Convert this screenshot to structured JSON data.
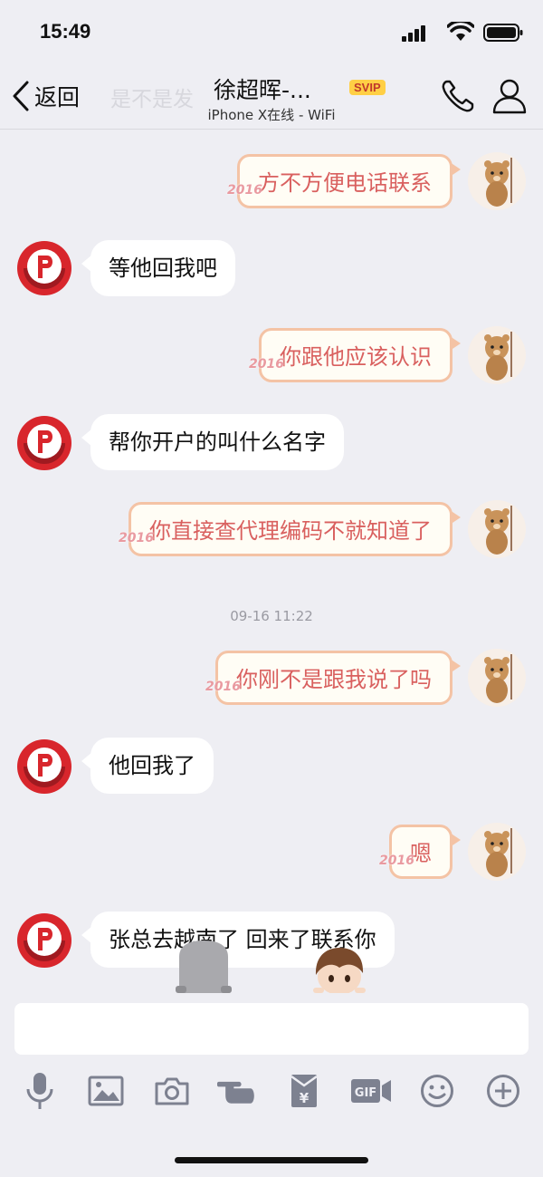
{
  "status_bar": {
    "time": "15:49"
  },
  "header": {
    "back_label": "返回",
    "ghost_text": "是不是发",
    "contact_name": "徐超晖-...",
    "badge": "SVIP",
    "subtitle": "iPhone X在线 - WiFi"
  },
  "messages": [
    {
      "side": "out",
      "text": "方不方便电话联系",
      "deco": "2016"
    },
    {
      "side": "in",
      "text": "等他回我吧"
    },
    {
      "side": "out",
      "text": "你跟他应该认识",
      "deco": "2016"
    },
    {
      "side": "in",
      "text": "帮你开户的叫什么名字"
    },
    {
      "side": "out",
      "text": "你直接查代理编码不就知道了",
      "deco": "2016"
    },
    {
      "side": "out",
      "text": "你刚不是跟我说了吗",
      "deco": "2016"
    },
    {
      "side": "in",
      "text": "他回我了"
    },
    {
      "side": "out",
      "text": "嗯",
      "deco": "2016"
    },
    {
      "side": "in",
      "text": "张总去越南了 回来了联系你"
    }
  ],
  "timestamp": "09-16 11:22",
  "input": {
    "value": ""
  },
  "toolbar": {
    "icons": [
      "microphone-icon",
      "image-icon",
      "camera-icon",
      "poke-hand-icon",
      "red-packet-icon",
      "gif-icon",
      "emoji-icon",
      "plus-icon"
    ],
    "gif_label": "GIF",
    "yen_label": "¥"
  },
  "colors": {
    "background": "#eeeef3",
    "outgoing_text": "#d9605f",
    "outgoing_border": "#f4c3a5",
    "svip": "#ffcf45"
  }
}
